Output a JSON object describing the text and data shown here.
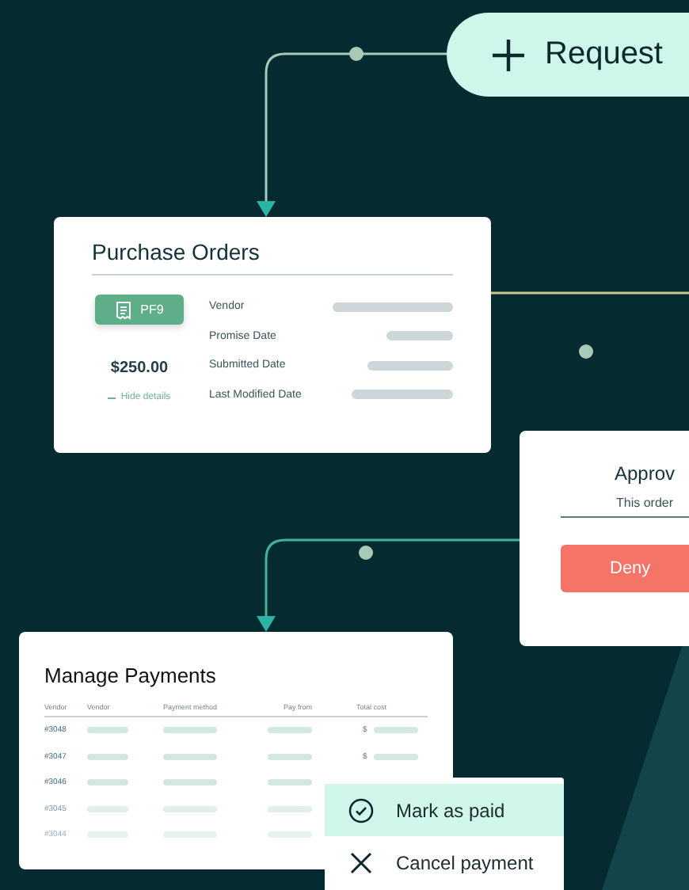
{
  "request_button": {
    "label": "Request"
  },
  "purchase_orders": {
    "title": "Purchase Orders",
    "badge": "PF9",
    "amount": "$250.00",
    "toggle": "Hide details",
    "fields": [
      "Vendor",
      "Promise Date",
      "Submitted Date",
      "Last Modified Date"
    ]
  },
  "approval": {
    "title": "Approv",
    "message": "This order",
    "deny_button": "Deny"
  },
  "payments": {
    "title": "Manage Payments",
    "columns": [
      "Vendor",
      "Vendor",
      "Payment method",
      "Pay from",
      "Total cost"
    ],
    "rows": [
      {
        "id": "#3048",
        "currency": "$"
      },
      {
        "id": "#3047",
        "currency": "$"
      },
      {
        "id": "#3046"
      },
      {
        "id": "#3045"
      },
      {
        "id": "#3044"
      }
    ]
  },
  "menu": [
    {
      "label": "Mark as paid",
      "kind": "check",
      "selected": true
    },
    {
      "label": "Cancel payment",
      "kind": "cancel",
      "selected": false
    }
  ]
}
